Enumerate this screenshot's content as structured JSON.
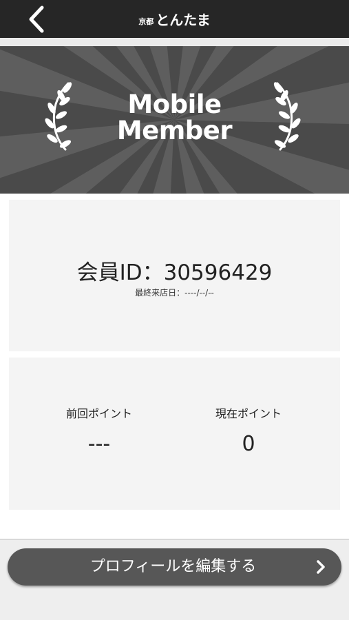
{
  "header": {
    "back_icon": "chevron-left-icon",
    "brand_small": "京都",
    "brand_main": "とんたま"
  },
  "banner": {
    "title_line1": "Mobile",
    "title_line2": "Member",
    "left_icon": "laurel-branch-icon",
    "right_icon": "laurel-branch-icon"
  },
  "member": {
    "id_text": "会員ID：30596429",
    "last_visit": "最終来店日：----/--/--"
  },
  "points": {
    "previous_label": "前回ポイント",
    "previous_value": "---",
    "current_label": "現在ポイント",
    "current_value": "0"
  },
  "footer": {
    "edit_profile_label": "プロフィールを編集する",
    "edit_icon": "chevron-right-icon"
  },
  "colors": {
    "header_bg": "#262626",
    "banner_bg": "#4d4d4d",
    "card_bg": "#f4f4f4",
    "button_bg": "#575757"
  }
}
